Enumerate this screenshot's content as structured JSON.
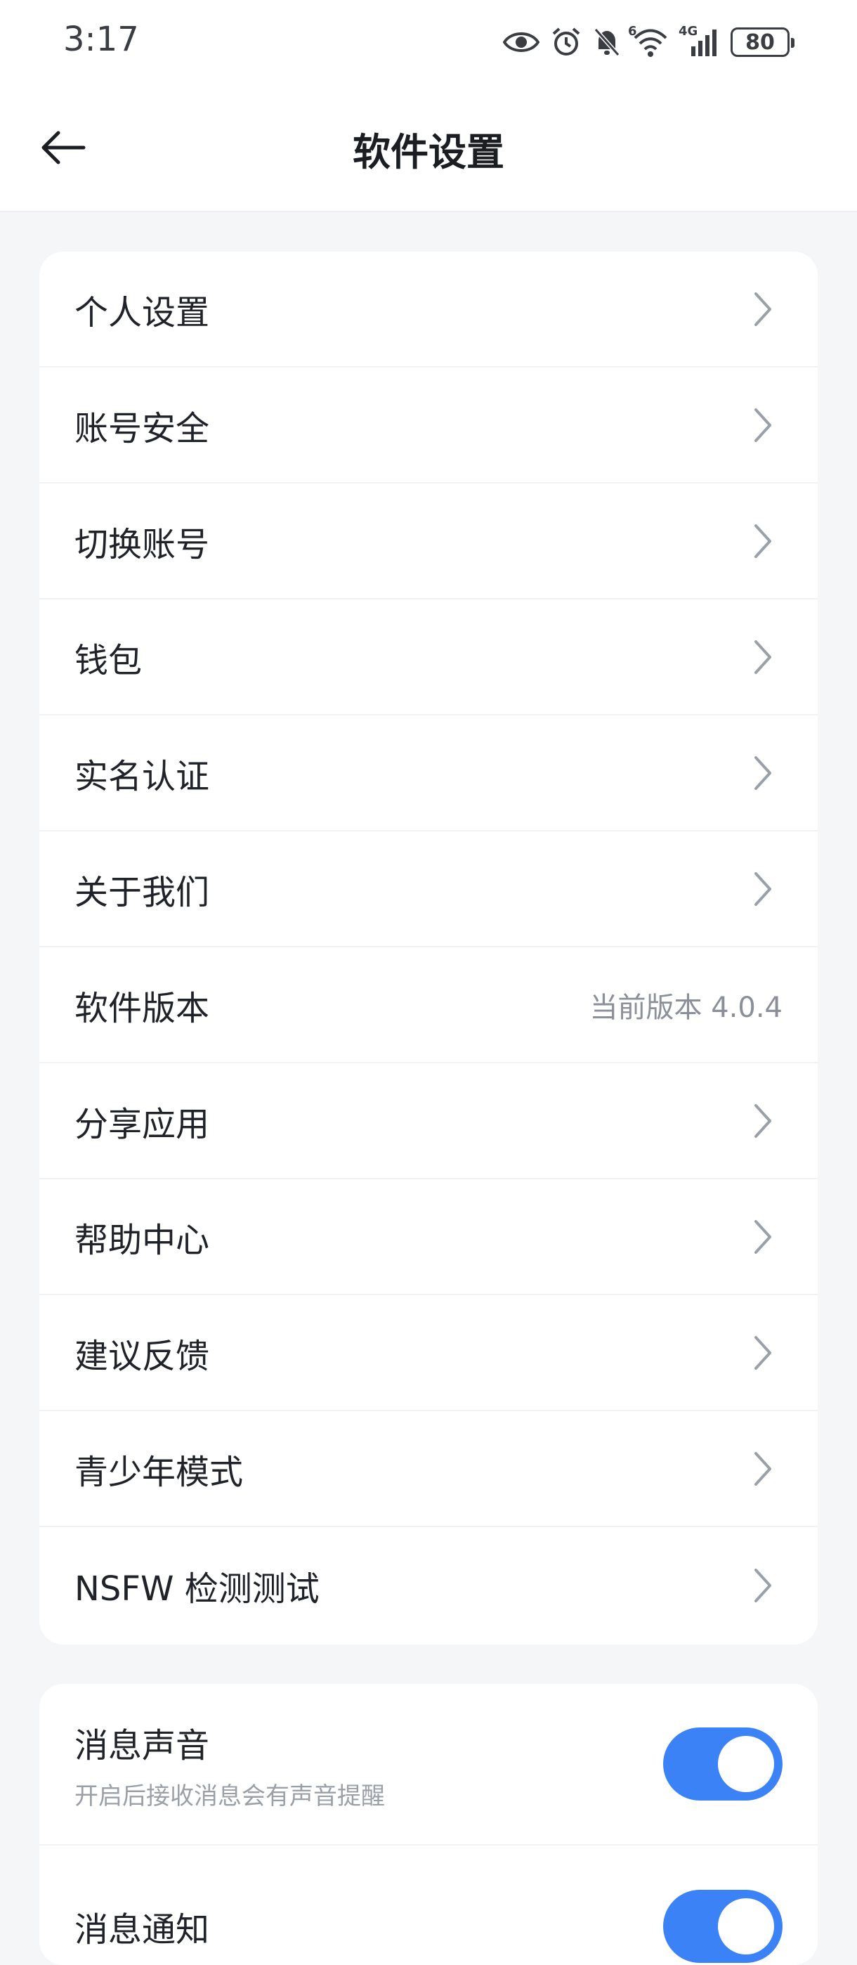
{
  "status_bar": {
    "time": "3:17",
    "icons": [
      "eye-icon",
      "alarm-icon",
      "bell-off-icon",
      "wifi-icon",
      "signal-icon"
    ],
    "network": "4G",
    "wifi_badge": "6",
    "battery": "80"
  },
  "header": {
    "title": "软件设置",
    "back_icon": "arrow-left-icon"
  },
  "menu": {
    "items": [
      {
        "label": "个人设置"
      },
      {
        "label": "账号安全"
      },
      {
        "label": "切换账号"
      },
      {
        "label": "钱包"
      },
      {
        "label": "实名认证"
      },
      {
        "label": "关于我们"
      },
      {
        "label": "软件版本",
        "value": "当前版本 4.0.4"
      },
      {
        "label": "分享应用"
      },
      {
        "label": "帮助中心"
      },
      {
        "label": "建议反馈"
      },
      {
        "label": "青少年模式"
      },
      {
        "label": "NSFW 检测测试"
      }
    ]
  },
  "notifications": {
    "items": [
      {
        "title": "消息声音",
        "desc": "开启后接收消息会有声音提醒",
        "enabled": true
      },
      {
        "title": "消息通知",
        "enabled": true
      }
    ]
  },
  "colors": {
    "accent": "#3b82f6",
    "background": "#f5f6f8",
    "card": "#ffffff"
  }
}
